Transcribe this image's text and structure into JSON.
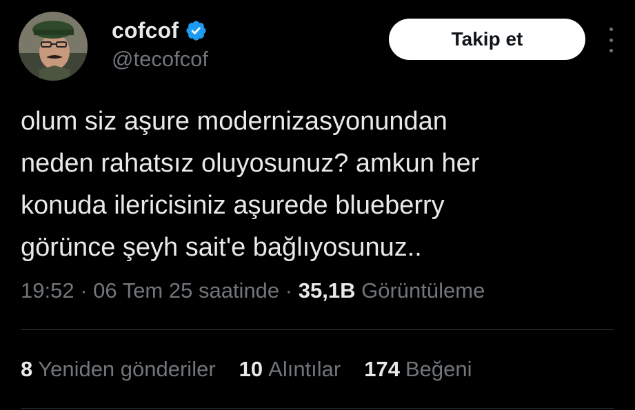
{
  "author": {
    "display_name": "cofcof",
    "handle": "@tecofcof",
    "verified": true
  },
  "actions": {
    "follow_label": "Takip et"
  },
  "tweet": {
    "lines": [
      "olum siz aşure modernizasyonundan",
      "neden rahatsız oluyosunuz? amkun her",
      "konuda ilericisiniz aşurede blueberry",
      "görünce şeyh sait'e bağlıyosunuz.."
    ]
  },
  "meta": {
    "time": "19:52",
    "date": "06 Tem 25 saatinde",
    "separator": "·",
    "views_count": "35,1B",
    "views_label": "Görüntüleme"
  },
  "stats": {
    "retweets": {
      "count": "8",
      "label": "Yeniden gönderiler"
    },
    "quotes": {
      "count": "10",
      "label": "Alıntılar"
    },
    "likes": {
      "count": "174",
      "label": "Beğeni"
    }
  },
  "colors": {
    "background": "#000000",
    "text_primary": "#e7e9ea",
    "text_secondary": "#71767b",
    "verified_blue": "#1d9bf0",
    "divider": "#2f3336",
    "button_bg": "#ffffff"
  }
}
